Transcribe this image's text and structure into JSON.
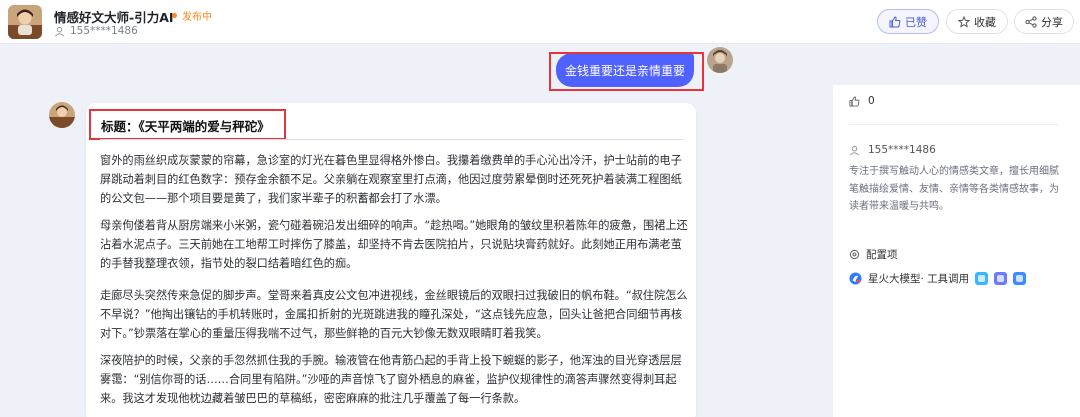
{
  "header": {
    "bot_name": "情感好文大师-引力AI",
    "status": "发布中",
    "author": "155****1486",
    "like_label": "已赞",
    "favorite_label": "收藏",
    "share_label": "分享"
  },
  "chat": {
    "user_message": "金钱重要还是亲情重要",
    "answer_title": "标题：《天平两端的爱与秤砣》",
    "paragraphs": [
      "窗外的雨丝织成灰蒙蒙的帘幕，急诊室的灯光在暮色里显得格外惨白。我攥着缴费单的手心沁出冷汗，护士站前的电子屏跳动着刺目的红色数字：预存金余额不足。父亲躺在观察室里打点滴，他因过度劳累晕倒时还死死护着装满工程图纸的公文包——那个项目要是黄了，我们家半辈子的积蓄都会打了水漂。",
      "母亲佝偻着背从厨房端来小米粥，瓷勺碰着碗沿发出细碎的响声。“趁热喝。”她眼角的皱纹里积着陈年的疲惫，围裙上还沾着水泥点子。三天前她在工地帮工时摔伤了膝盖，却坚持不肯去医院拍片，只说贴块膏药就好。此刻她正用布满老茧的手替我整理衣领，指节处的裂口结着暗红色的痂。",
      "走廊尽头突然传来急促的脚步声。堂哥来着真皮公文包冲进视线，金丝眼镜后的双眼扫过我破旧的帆布鞋。“叔住院怎么不早说？”他掏出镶钻的手机转账时，金属扣折射的光斑跳进我的瞳孔深处，“这点钱先应急，回头让爸把合同细节再核对下。”钞票落在掌心的重量压得我喘不过气，那些鲜艳的百元大钞像无数双眼睛盯着我笑。",
      "深夜陪护的时候，父亲的手忽然抓住我的手腕。输液管在他青筋凸起的手背上投下蜿蜒的影子，他浑浊的目光穿透层层雾霭：“别信你哥的话……合同里有陷阱。”沙哑的声音惊飞了窗外栖息的麻雀，监护仪规律性的滴答声骤然变得刺耳起来。我这才发现他枕边藏着皱巴巴的草稿纸，密密麻麻的批注几乎覆盖了每一行条款。"
    ]
  },
  "side_panel": {
    "likes": "0",
    "author": "155****1486",
    "description": "专注于撰写触动人心的情感类文章，擅长用细腻笔触描绘爱情、友情、亲情等各类情感故事，为读者带来温暖与共鸣。",
    "config_label": "配置项",
    "model_label": "星火大模型· 工具调用"
  },
  "colors": {
    "accent": "#4f62ff",
    "status": "#ff8a1a",
    "highlight": "#e8333a",
    "background": "#eef1f7"
  },
  "icons": [
    "thumbs-up-icon",
    "star-icon",
    "share-icon",
    "user-icon",
    "gear-icon",
    "spark-model-icon"
  ]
}
